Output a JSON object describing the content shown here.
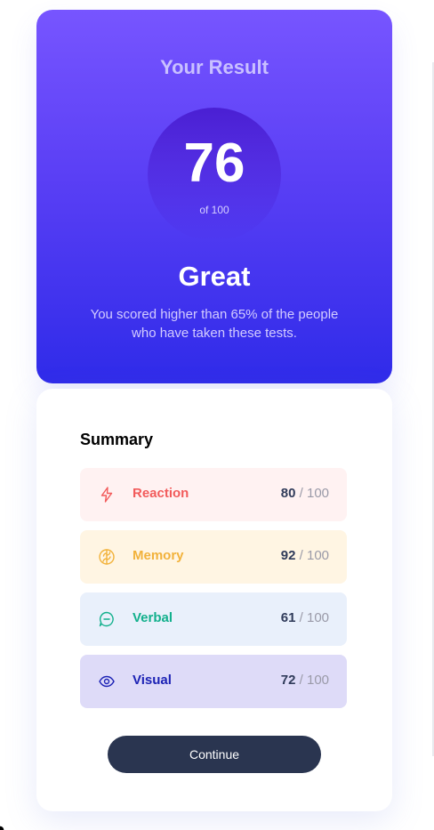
{
  "result": {
    "title": "Your Result",
    "score": "76",
    "score_max": "of 100",
    "rating": "Great",
    "description": "You scored higher than 65% of the people who have taken these tests."
  },
  "summary": {
    "title": "Summary",
    "items": [
      {
        "label": "Reaction",
        "score": "80",
        "max": " / 100",
        "icon": "lightning-icon",
        "color": "#f25b5b",
        "bg": "#fff2f2"
      },
      {
        "label": "Memory",
        "score": "92",
        "max": " / 100",
        "icon": "brain-icon",
        "color": "#f2b23b",
        "bg": "#fff5e3"
      },
      {
        "label": "Verbal",
        "score": "61",
        "max": " / 100",
        "icon": "chat-icon",
        "color": "#12b08c",
        "bg": "#e9f0fb"
      },
      {
        "label": "Visual",
        "score": "72",
        "max": " / 100",
        "icon": "eye-icon",
        "color": "#1c22b5",
        "bg": "#dedbf8"
      }
    ]
  },
  "actions": {
    "continue_label": "Continue"
  },
  "colors": {
    "gradient_top": "#7755ff",
    "gradient_bottom": "#2f2be9",
    "button": "#2a3550"
  }
}
